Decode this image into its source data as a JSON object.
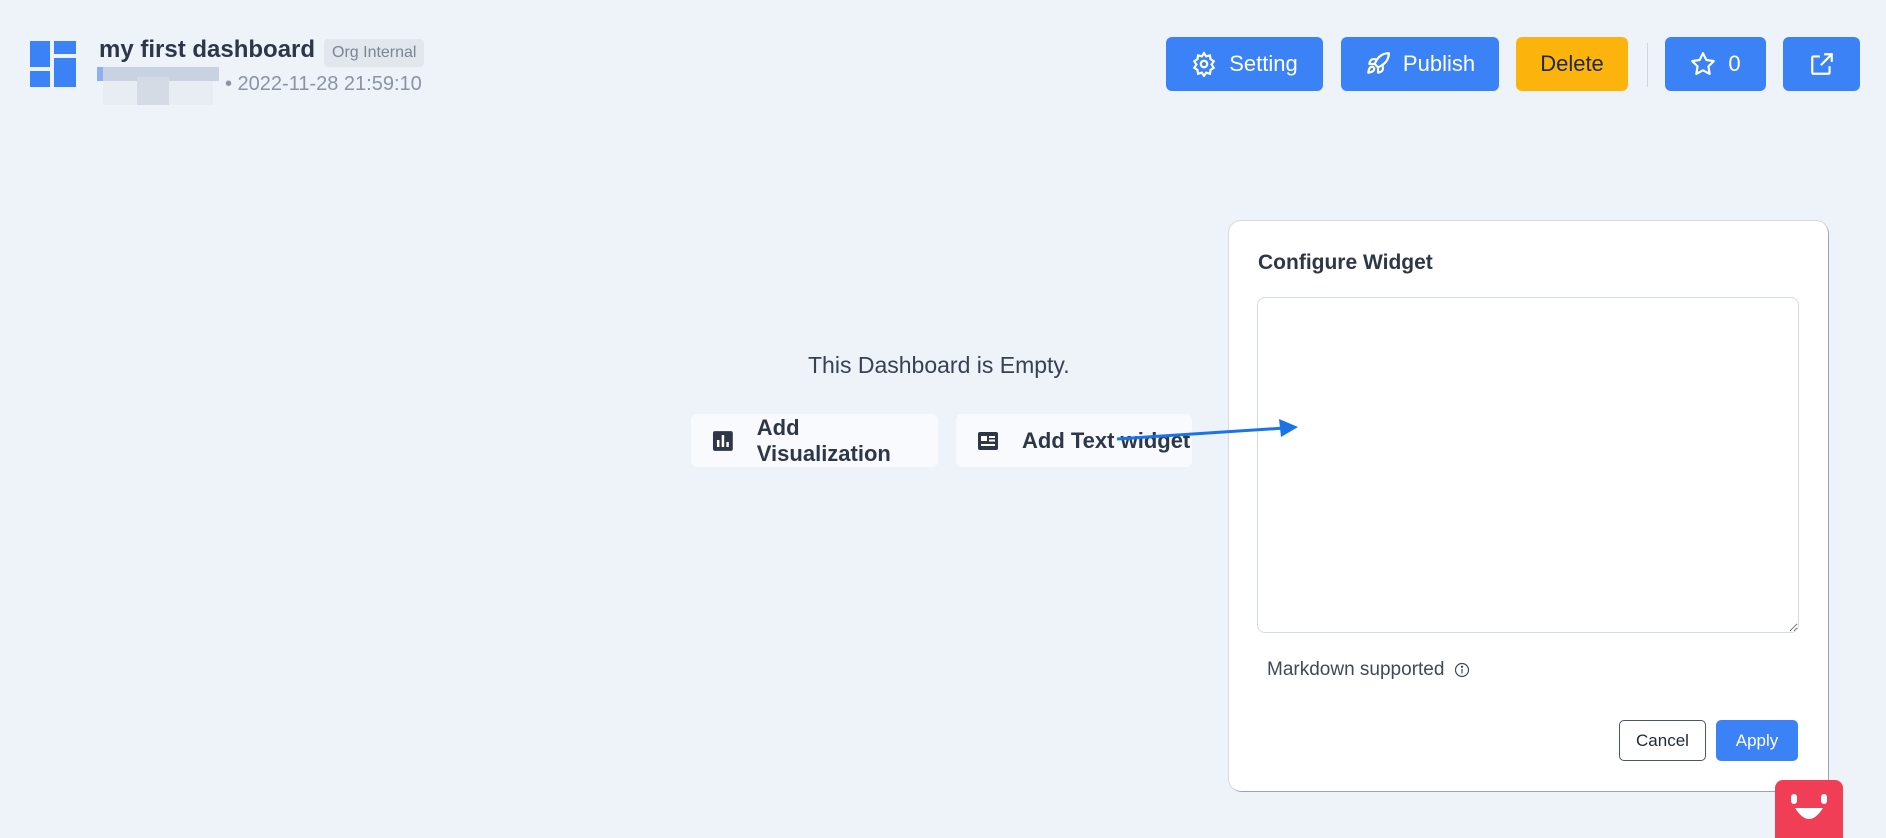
{
  "header": {
    "title": "my first dashboard",
    "visibility_badge": "Org Internal",
    "timestamp": "• 2022-11-28 21:59:10",
    "buttons": {
      "setting": "Setting",
      "publish": "Publish",
      "delete": "Delete",
      "star_count": "0"
    },
    "icons": [
      "dashboard-logo-icon",
      "gear-icon",
      "rocket-icon",
      "star-icon",
      "external-link-icon"
    ]
  },
  "empty_state": {
    "message": "This Dashboard is Empty.",
    "add_visualization": "Add Visualization",
    "add_text_widget": "Add Text widget"
  },
  "modal": {
    "title": "Configure Widget",
    "textarea_value": "",
    "markdown_note": "Markdown supported",
    "cancel": "Cancel",
    "apply": "Apply"
  },
  "colors": {
    "primary": "#3a82f6",
    "delete": "#fcb40d",
    "background": "#eef2f9",
    "bot": "#ef3e56"
  }
}
